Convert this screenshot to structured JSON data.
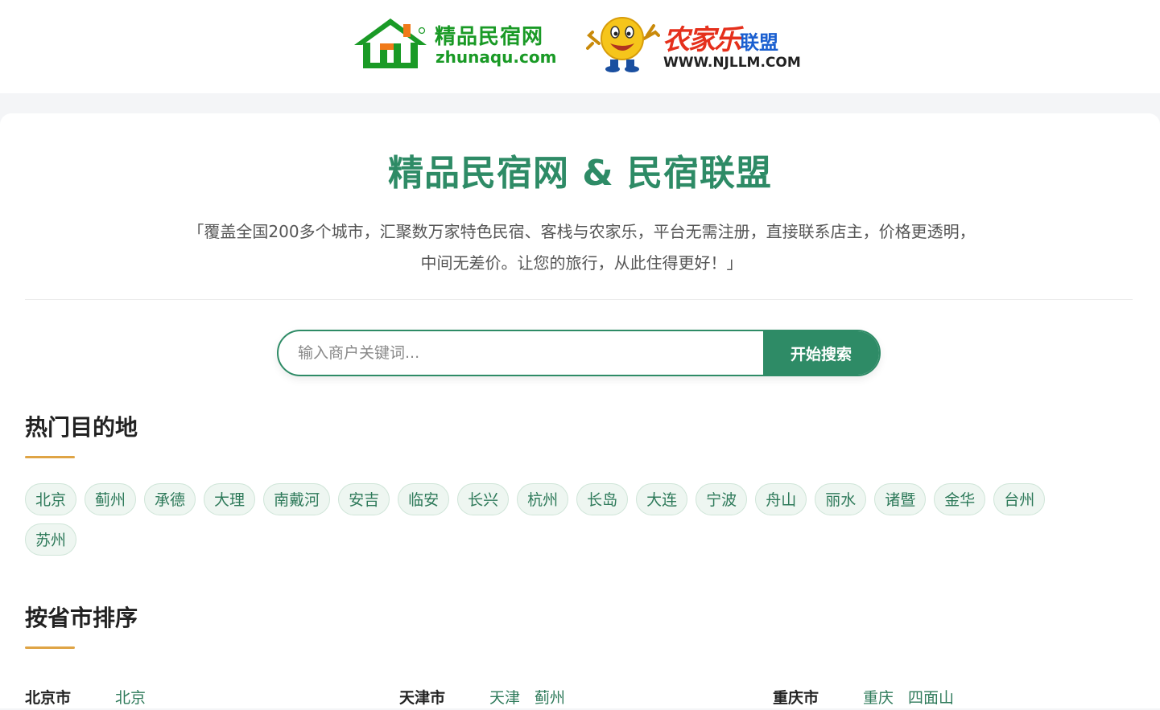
{
  "header": {
    "logo1": {
      "cn": "精品民宿网",
      "en": "zhunaqu.com",
      "mark": "®"
    },
    "logo2": {
      "cn1": "农家乐",
      "cn2": "联盟",
      "en": "WWW.NJLLM.COM"
    }
  },
  "hero": {
    "title": "精品民宿网 & 民宿联盟",
    "description": "「覆盖全国200多个城市，汇聚数万家特色民宿、客栈与农家乐，平台无需注册，直接联系店主，价格更透明，中间无差价。让您的旅行，从此住得更好！」"
  },
  "search": {
    "placeholder": "输入商户关键词...",
    "value": "",
    "button_label": "开始搜索"
  },
  "hot": {
    "title": "热门目的地",
    "tags": [
      "北京",
      "蓟州",
      "承德",
      "大理",
      "南戴河",
      "安吉",
      "临安",
      "长兴",
      "杭州",
      "长岛",
      "大连",
      "宁波",
      "舟山",
      "丽水",
      "诸暨",
      "金华",
      "台州",
      "苏州"
    ]
  },
  "provinces": {
    "title": "按省市排序",
    "rows": [
      {
        "name": "北京市",
        "cities": [
          "北京"
        ]
      },
      {
        "name": "天津市",
        "cities": [
          "天津",
          "蓟州"
        ]
      },
      {
        "name": "重庆市",
        "cities": [
          "重庆",
          "四面山"
        ]
      }
    ]
  },
  "colors": {
    "primary_green": "#2e8b66",
    "accent_gold": "#dfa445",
    "tag_bg": "#eef6f1",
    "logo_green": "#1a9a26",
    "logo_red": "#e5301c",
    "logo_blue": "#1a5fd0"
  }
}
